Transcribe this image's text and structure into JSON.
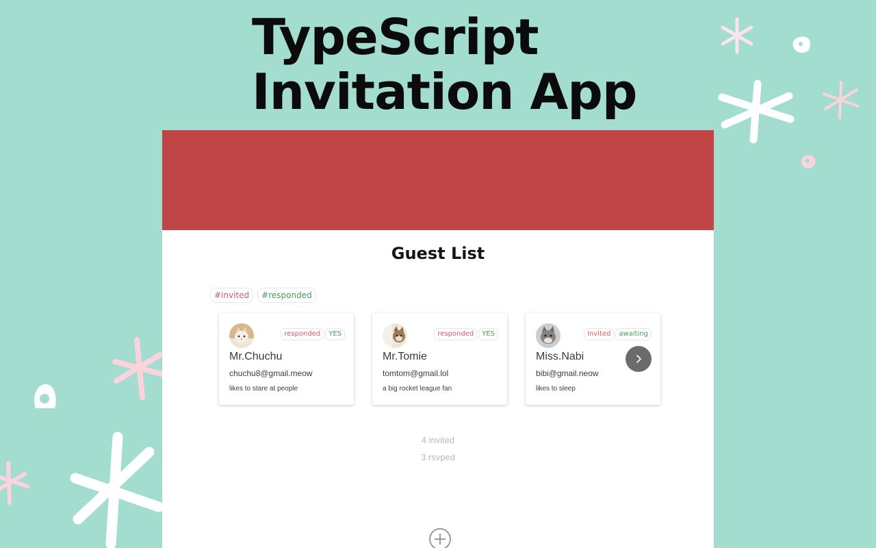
{
  "hero": {
    "title_line1": "TypeScript",
    "title_line2": "Invitation App"
  },
  "guest_list": {
    "title": "Guest List",
    "filters": [
      {
        "label": "#invited",
        "color": "#d45a5d"
      },
      {
        "label": "#responded",
        "color": "#4a9a58"
      }
    ],
    "guests": [
      {
        "name": "Mr.Chuchu",
        "email": "chuchu8@gmail.meow",
        "note": "likes to stare at people",
        "status": "responded",
        "rsvp": "YES",
        "avatar": "cat-avatar-icon"
      },
      {
        "name": "Mr.Tomie",
        "email": "tomtom@gmail.lol",
        "note": "a big rocket league fan",
        "status": "responded",
        "rsvp": "YES",
        "avatar": "cat-avatar-icon"
      },
      {
        "name": "Miss.Nabi",
        "email": "bibi@gmail.neow",
        "note": "likes to sleep",
        "status": "invited",
        "rsvp": "awaiting",
        "avatar": "cat-avatar-icon"
      }
    ],
    "stats": {
      "invited": "4 invited",
      "rsvped": "3 rsvped"
    },
    "next_icon": "chevron-right-icon",
    "add_icon": "plus-circle-icon"
  },
  "colors": {
    "background": "#a3ddcf",
    "header_red": "#c14447",
    "tag_red": "#d45a5d",
    "tag_green": "#4a9a58"
  }
}
